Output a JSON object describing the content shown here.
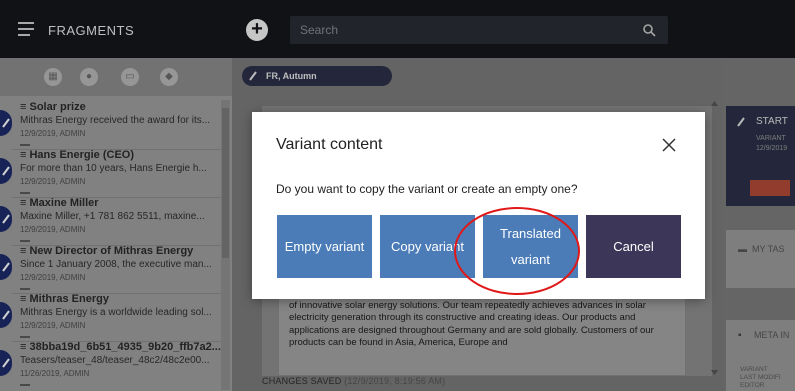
{
  "topbar": {
    "title": "FRAGMENTS",
    "add_label": "+",
    "search_placeholder": "Search"
  },
  "filters": [
    {
      "icon": "calendar-filter-icon"
    },
    {
      "icon": "person-filter-icon"
    },
    {
      "icon": "media-filter-icon"
    },
    {
      "icon": "tag-filter-icon"
    }
  ],
  "list": [
    {
      "title": "Solar prize",
      "desc": "Mithras Energy received the award for its...",
      "meta": "12/9/2019, ADMIN"
    },
    {
      "title": "Hans Energie (CEO)",
      "desc": "For more than 10 years, Hans Energie h...",
      "meta": "12/9/2019, ADMIN"
    },
    {
      "title": "Maxine Miller",
      "desc": "Maxine Miller, +1 781 862 5511, maxine...",
      "meta": "12/9/2019, ADMIN"
    },
    {
      "title": "New Director of Mithras Energy",
      "desc": "Since 1 January 2008, the executive man...",
      "meta": "12/9/2019, ADMIN"
    },
    {
      "title": "Mithras Energy",
      "desc": "Mithras Energy is a worldwide leading sol...",
      "meta": "12/9/2019, ADMIN"
    },
    {
      "title": "38bba19d_6b51_4935_9b20_ffb7a2...",
      "desc": "Teasers/teaser_48/teaser_48c2/48c2e00...",
      "meta": "11/26/2019, ADMIN"
    }
  ],
  "center": {
    "pill_label": "FR, Autumn",
    "editor_text": "Mithras Energy is a worldwide leading solar corporation in the development and manufacture of innovative solar energy solutions. Our team repeatedly achieves advances in solar electricity generation through its constructive and creating ideas. Our products and applications are designed throughout Germany and are sold globally. Customers of our products can be found in Asia, America, Europe and",
    "status_label": "CHANGES SAVED",
    "status_time": "(12/9/2019, 8:19:56 AM)"
  },
  "right": {
    "start_title": "START",
    "start_sub1": "VARIANT",
    "start_sub2": "12/9/2019",
    "tasks_label": "MY TAS",
    "meta_label": "META IN",
    "meta_rows": [
      "VARIANT",
      "LAST MODIFI",
      "EDITOR"
    ]
  },
  "dialog": {
    "title": "Variant content",
    "question": "Do you want to copy the variant or create an empty one?",
    "buttons": {
      "empty": "Empty variant",
      "copy": "Copy variant",
      "translated_line1": "Translated",
      "translated_line2": "variant",
      "cancel": "Cancel"
    }
  },
  "colors": {
    "topbar": "#15161c",
    "primary_button": "#4b7cb7",
    "cancel_button": "#3c3758",
    "annotation": "#e01818"
  }
}
